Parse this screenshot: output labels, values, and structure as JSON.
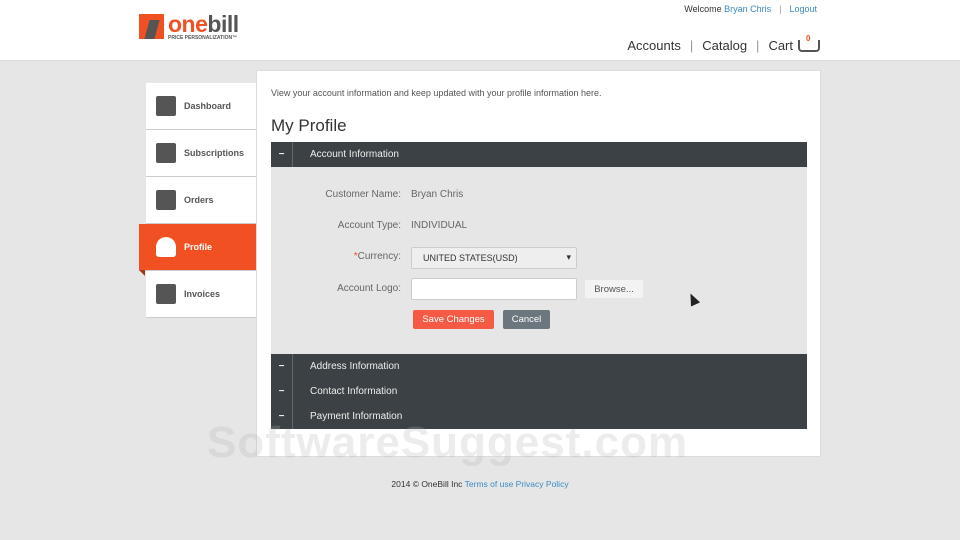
{
  "logo": {
    "name_a": "one",
    "name_b": "bill",
    "tagline": "PRICE PERSONALIZATION™"
  },
  "topbar": {
    "welcome": "Welcome",
    "user": "Bryan Chris",
    "logout": "Logout"
  },
  "nav": {
    "accounts": "Accounts",
    "catalog": "Catalog",
    "cart": "Cart",
    "cart_count": "0"
  },
  "sidebar": {
    "items": [
      {
        "label": "Dashboard"
      },
      {
        "label": "Subscriptions"
      },
      {
        "label": "Orders"
      },
      {
        "label": "Profile"
      },
      {
        "label": "Invoices"
      }
    ]
  },
  "main": {
    "intro": "View your account information and keep updated with your profile information here.",
    "title": "My Profile",
    "sections": [
      {
        "label": "Account Information",
        "toggle": "−"
      },
      {
        "label": "Address Information",
        "toggle": "−"
      },
      {
        "label": "Contact Information",
        "toggle": "−"
      },
      {
        "label": "Payment Information",
        "toggle": "−"
      }
    ],
    "form": {
      "customer_name_label": "Customer Name:",
      "customer_name": "Bryan Chris",
      "account_type_label": "Account Type:",
      "account_type": "INDIVIDUAL",
      "currency_required": "*",
      "currency_label": "Currency:",
      "currency": "UNITED STATES(USD)",
      "logo_label": "Account Logo:",
      "browse": "Browse...",
      "save": "Save Changes",
      "cancel": "Cancel"
    }
  },
  "watermark": "SoftwareSuggest.com",
  "footer": {
    "copyright": "2014 © OneBill Inc",
    "terms": "Terms of use",
    "privacy": "Privacy Policy"
  },
  "colors": {
    "accent": "#f05022",
    "section_bar": "#3b4144",
    "link": "#3a8cc4"
  }
}
